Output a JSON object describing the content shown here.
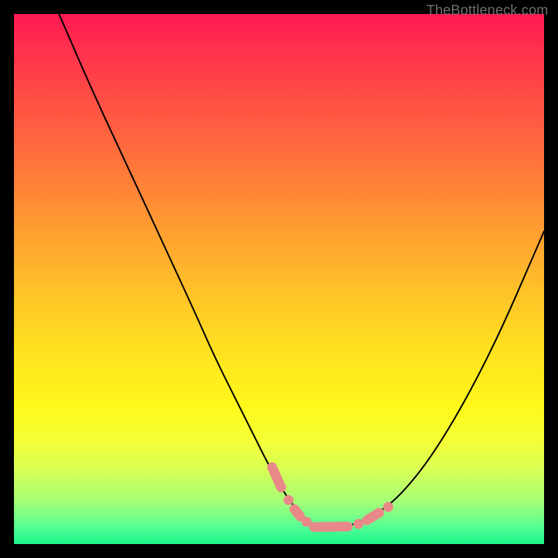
{
  "watermark": "TheBottleneck.com",
  "colors": {
    "frame": "#000000",
    "watermark": "#6e6e6e",
    "curve_stroke": "#000000",
    "marker_fill": "#e98888",
    "gradient_top": "#ff1a52",
    "gradient_bottom": "#17f58b"
  },
  "chart_data": {
    "type": "line",
    "title": "",
    "xlabel": "",
    "ylabel": "",
    "xlim": [
      0,
      100
    ],
    "ylim": [
      0,
      100
    ],
    "grid": false,
    "series": [
      {
        "name": "curve",
        "x": [
          8.5,
          15,
          22,
          28,
          34,
          38,
          42,
          45,
          48,
          50.5,
          52.5,
          54.5,
          56.5,
          58,
          60,
          63,
          66,
          72,
          80,
          90,
          100
        ],
        "values": [
          100,
          85,
          70,
          57,
          44,
          35,
          27,
          21,
          15,
          10.5,
          7.5,
          5.2,
          3.6,
          3,
          3,
          3.4,
          4.4,
          8,
          18,
          36,
          59
        ]
      }
    ],
    "markers": [
      {
        "shape": "pill",
        "x1": 48.7,
        "y1": 14.5,
        "x2": 50.4,
        "y2": 10.7
      },
      {
        "shape": "dot",
        "x": 51.8,
        "y": 8.3,
        "r": 0.95
      },
      {
        "shape": "pill",
        "x1": 52.9,
        "y1": 6.6,
        "x2": 54.0,
        "y2": 5.2
      },
      {
        "shape": "dot",
        "x": 55.2,
        "y": 4.2,
        "r": 0.95
      },
      {
        "shape": "pill",
        "x1": 56.6,
        "y1": 3.2,
        "x2": 63.0,
        "y2": 3.3
      },
      {
        "shape": "dot",
        "x": 65.0,
        "y": 3.8,
        "r": 0.95
      },
      {
        "shape": "pill",
        "x1": 66.6,
        "y1": 4.5,
        "x2": 68.9,
        "y2": 5.9
      },
      {
        "shape": "dot",
        "x": 70.6,
        "y": 7.0,
        "r": 0.95
      }
    ]
  }
}
